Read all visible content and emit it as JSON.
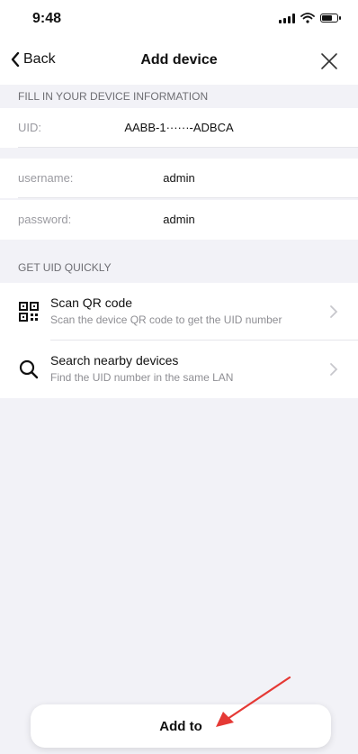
{
  "status": {
    "time": "9:48"
  },
  "nav": {
    "back_label": "Back",
    "title": "Add device"
  },
  "device_info": {
    "header": "FILL IN YOUR DEVICE INFORMATION",
    "fields": [
      {
        "label": "UID:",
        "value": "AABB-1······-ADBCA"
      },
      {
        "label": "username:",
        "value": "admin"
      },
      {
        "label": "password:",
        "value": "admin"
      }
    ]
  },
  "quick": {
    "header": "GET UID QUICKLY",
    "items": [
      {
        "title": "Scan QR code",
        "subtitle": "Scan the device QR code to get the UID number",
        "icon": "qr-code-icon"
      },
      {
        "title": "Search nearby devices",
        "subtitle": "Find the UID number in the same LAN",
        "icon": "search-icon"
      }
    ]
  },
  "footer": {
    "add_label": "Add to"
  },
  "colors": {
    "background": "#f2f2f7",
    "annotation_arrow": "#e53935"
  }
}
